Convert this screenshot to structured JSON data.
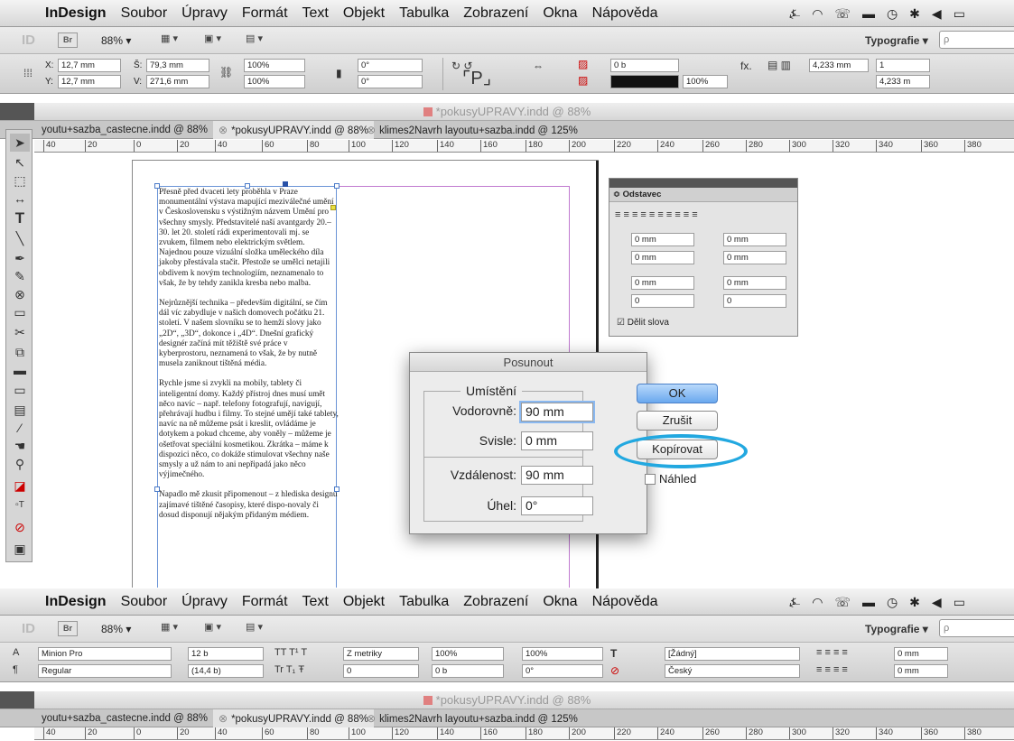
{
  "menubar": {
    "app": "InDesign",
    "items": [
      "Soubor",
      "Úpravy",
      "Formát",
      "Text",
      "Objekt",
      "Tabulka",
      "Zobrazení",
      "Okna",
      "Nápověda"
    ]
  },
  "apptoolbar": {
    "br_label": "Br",
    "zoom": "88% ▾",
    "workspace": "Typografie ▾",
    "search_placeholder": "ρ"
  },
  "control1": {
    "x": "12,7 mm",
    "y": "12,7 mm",
    "w": "79,3 mm",
    "h": "271,6 mm",
    "scale_x": "100%",
    "scale_y": "100%",
    "angle": "0°",
    "shear": "0°",
    "stroke": "0 b",
    "opacity": "100%",
    "col_w": "4,233 mm",
    "cols": "1",
    "gutter": "4,233 m"
  },
  "document": {
    "title": "*pokusyUPRAVY.indd @ 88%"
  },
  "tabs": [
    {
      "label": "youtu+sazba_castecne.indd @ 88%"
    },
    {
      "label": "*pokusyUPRAVY.indd @ 88%"
    },
    {
      "label": "klimes2Navrh layoutu+sazba.indd @ 125%"
    }
  ],
  "ruler": [
    "40",
    "20",
    "0",
    "20",
    "40",
    "60",
    "80",
    "100",
    "120",
    "140",
    "160",
    "180",
    "200",
    "220",
    "240",
    "260",
    "280",
    "300",
    "320",
    "340",
    "360",
    "380"
  ],
  "text_frame": {
    "paragraphs": [
      "Přesně před dvaceti lety proběhla v Praze monumentální výstava mapující meziválečné umění v Československu s výstižným názvem Umění pro všechny smysly. Představitelé naší avantgardy 20.–30. let 20. století rádi experimentovali mj. se zvukem, filmem nebo elektrickým světlem. Najednou pouze vizuální složka uměleckého díla jakoby přestávala stačit. Přestože se umělci netajili obdivem k novým technologiím, neznamenalo to však, že by tehdy zanikla kresba nebo malba.",
      "Nejrůznější technika – především digitální, se čím dál víc zabydluje v našich domovech počátku 21. století. V našem slovníku se to hemží slovy jako „2D“, „3D“, dokonce i „4D“. Dnešní grafický designér začíná mít těžiště své práce v kyberprostoru, neznamená to však, že by nutně musela zaniknout tištěná média.",
      "Rychle jsme si zvykli na mobily, tablety či inteligentní domy. Každý přístroj dnes musí umět něco navíc – např. telefony fotografují, navigují, přehrávají hudbu i filmy. To stejné umějí také tablety, navíc na ně můžeme psát i kreslit, ovládáme je dotykem a pokud chceme, aby voněly – můžeme je ošetřovat speciální kosmetikou. Zkrátka – máme k dispozici něco, co dokáže stimulovat všechny naše smysly a už nám to ani nepřipadá jako něco výjimečného.",
      "Napadlo mě zkusit připomenout – z hlediska designu zajímavé tištěné časopisy, které dispo-novaly či dosud disponují nějakým přidaným médiem."
    ]
  },
  "para_panel": {
    "title": "≎ Odstavec",
    "left_indent": "0 mm",
    "right_indent": "0 mm",
    "first_indent": "0 mm",
    "last_indent": "0 mm",
    "space_before": "0 mm",
    "space_after": "0 mm",
    "drop_lines": "0",
    "drop_chars": "0",
    "hyphenate": "Dělit slova"
  },
  "dialog": {
    "title": "Posunout",
    "group": "Umístění",
    "h_label": "Vodorovně:",
    "h_value": "90 mm",
    "v_label": "Svisle:",
    "v_value": "0 mm",
    "d_label": "Vzdálenost:",
    "d_value": "90 mm",
    "a_label": "Úhel:",
    "a_value": "0°",
    "ok": "OK",
    "cancel": "Zrušit",
    "copy": "Kopírovat",
    "preview": "Náhled"
  },
  "control2": {
    "font": "Minion Pro",
    "style": "Regular",
    "size": "12 b",
    "leading": "(14,4 b)",
    "kerning": "Z metriky",
    "tracking": "0",
    "vscale": "100%",
    "hscale": "100%",
    "baseline": "0 b",
    "skew": "0°",
    "char_style": "[Žádný]",
    "language": "Český",
    "indent_l": "0 mm",
    "indent_r": "0 mm"
  }
}
